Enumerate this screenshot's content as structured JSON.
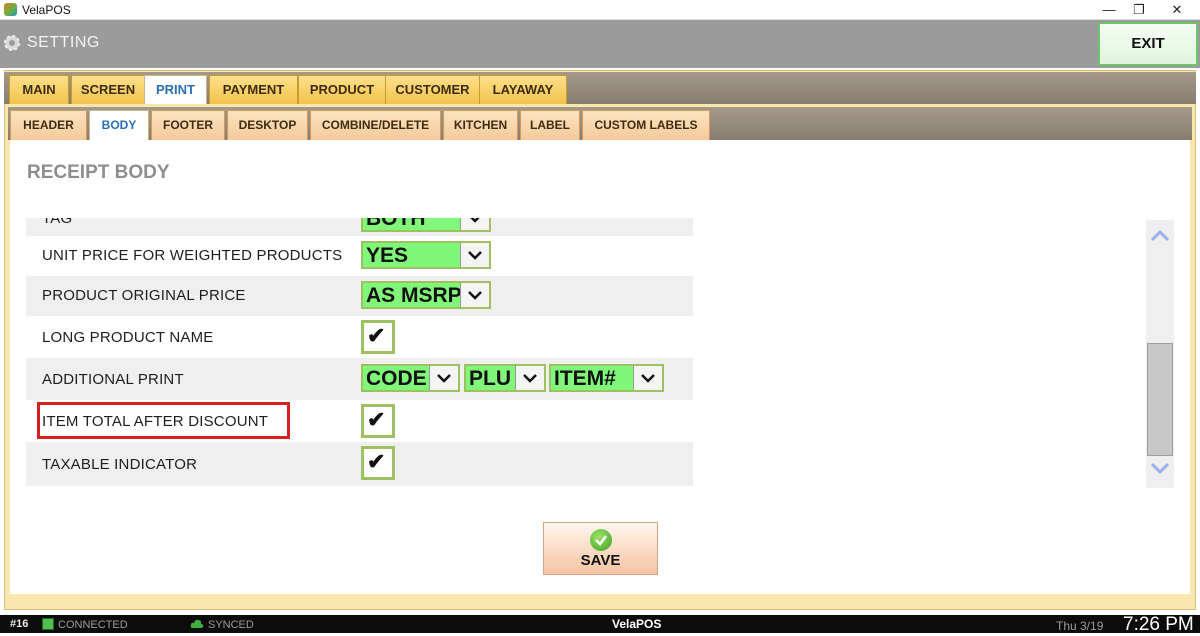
{
  "window": {
    "title": "VelaPOS",
    "minimize_glyph": "—",
    "restore_glyph": "❐",
    "close_glyph": "✕"
  },
  "header": {
    "title": "SETTING",
    "exit_label": "EXIT",
    "icon": "gear-icon"
  },
  "main_tabs": [
    {
      "label": "MAIN",
      "active": false
    },
    {
      "label": "SCREEN",
      "active": false
    },
    {
      "label": "PRINT",
      "active": true
    },
    {
      "label": "PAYMENT",
      "active": false
    },
    {
      "label": "PRODUCT",
      "active": false
    },
    {
      "label": "CUSTOMER",
      "active": false
    },
    {
      "label": "LAYAWAY",
      "active": false
    }
  ],
  "sub_tabs": [
    {
      "label": "HEADER",
      "active": false
    },
    {
      "label": "BODY",
      "active": true
    },
    {
      "label": "FOOTER",
      "active": false
    },
    {
      "label": "DESKTOP",
      "active": false
    },
    {
      "label": "COMBINE/DELETE",
      "active": false
    },
    {
      "label": "KITCHEN",
      "active": false
    },
    {
      "label": "LABEL",
      "active": false
    },
    {
      "label": "CUSTOM LABELS",
      "active": false
    }
  ],
  "section": {
    "title": "RECEIPT BODY"
  },
  "settings": {
    "rows": [
      {
        "label": "TAG",
        "control": "dropdown",
        "value": "BOTH"
      },
      {
        "label": "UNIT PRICE FOR WEIGHTED PRODUCTS",
        "control": "dropdown",
        "value": "YES"
      },
      {
        "label": "PRODUCT ORIGINAL PRICE",
        "control": "dropdown",
        "value": "AS MSRP"
      },
      {
        "label": "LONG PRODUCT NAME",
        "control": "checkbox",
        "checked": true
      },
      {
        "label": "ADDITIONAL PRINT",
        "control": "dropdowns",
        "values": [
          "CODE",
          "PLU",
          "ITEM#"
        ]
      },
      {
        "label": "ITEM TOTAL AFTER DISCOUNT",
        "control": "checkbox",
        "checked": true,
        "highlighted": true
      },
      {
        "label": "TAXABLE INDICATOR",
        "control": "checkbox",
        "checked": true
      }
    ],
    "check_glyph": "✔",
    "dropdown_arrow": "chevron-down-icon"
  },
  "save": {
    "label": "SAVE",
    "icon": "check-circle-icon"
  },
  "status_bar": {
    "station": "#16",
    "connection": "CONNECTED",
    "sync": "SYNCED",
    "brand": "VelaPOS",
    "date": "Thu 3/19",
    "time": "7:26 PM"
  },
  "colors": {
    "header_bg": "#9b9b9b",
    "tab_bg": "#f3c34c",
    "subtab_bg": "#f6c99b",
    "frame_bg": "#f9e6ad",
    "control_green": "#81f77a",
    "highlight_red": "#d62020",
    "active_tab_text": "#2a6fb4"
  }
}
